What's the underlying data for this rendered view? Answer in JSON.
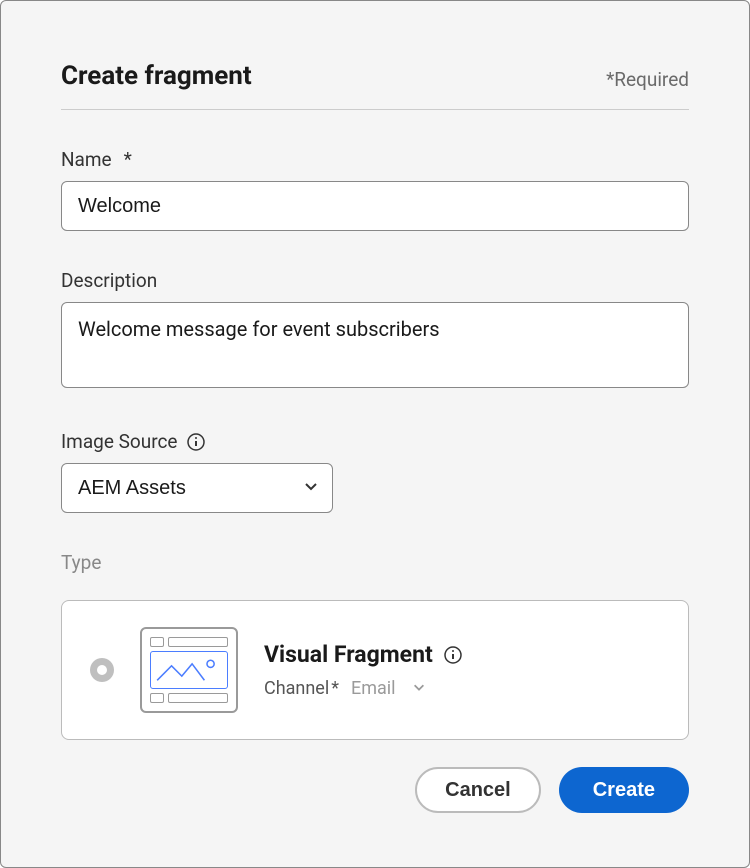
{
  "header": {
    "title": "Create fragment",
    "required_note": "*Required"
  },
  "fields": {
    "name": {
      "label": "Name",
      "asterisk": "*",
      "value": "Welcome"
    },
    "description": {
      "label": "Description",
      "value": "Welcome message for event subscribers"
    },
    "image_source": {
      "label": "Image Source",
      "value": "AEM Assets"
    },
    "type": {
      "label": "Type",
      "option_title": "Visual Fragment",
      "channel_label": "Channel",
      "channel_asterisk": "*",
      "channel_value": "Email"
    }
  },
  "buttons": {
    "cancel": "Cancel",
    "create": "Create"
  }
}
